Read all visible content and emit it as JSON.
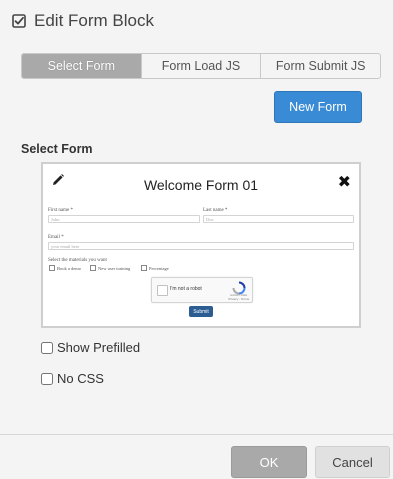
{
  "dialog": {
    "title": "Edit Form Block"
  },
  "tabs": [
    {
      "label": "Select Form",
      "active": true
    },
    {
      "label": "Form Load JS",
      "active": false
    },
    {
      "label": "Form Submit JS",
      "active": false
    }
  ],
  "new_form_label": "New Form",
  "section_label": "Select Form",
  "preview": {
    "title": "Welcome Form 01",
    "first_name_label": "First name *",
    "first_name_placeholder": "John",
    "last_name_label": "Last name *",
    "last_name_placeholder": "Doe",
    "email_label": "Email *",
    "email_placeholder": "your email here",
    "materials_label": "Select the materials you want",
    "materials": [
      "Book a demo",
      "New user training",
      "Percentage"
    ],
    "captcha_text": "I'm not a robot",
    "captcha_sub": "reCAPTCHA\nPrivacy - Terms",
    "submit_label": "Submit"
  },
  "options": {
    "show_prefilled": {
      "label": "Show Prefilled",
      "checked": false
    },
    "no_css": {
      "label": "No CSS",
      "checked": false
    }
  },
  "footer": {
    "ok_label": "OK",
    "cancel_label": "Cancel"
  },
  "colors": {
    "primary": "#3a8bd6",
    "tab_active": "#a9a9a9",
    "submit": "#2b5d93"
  }
}
